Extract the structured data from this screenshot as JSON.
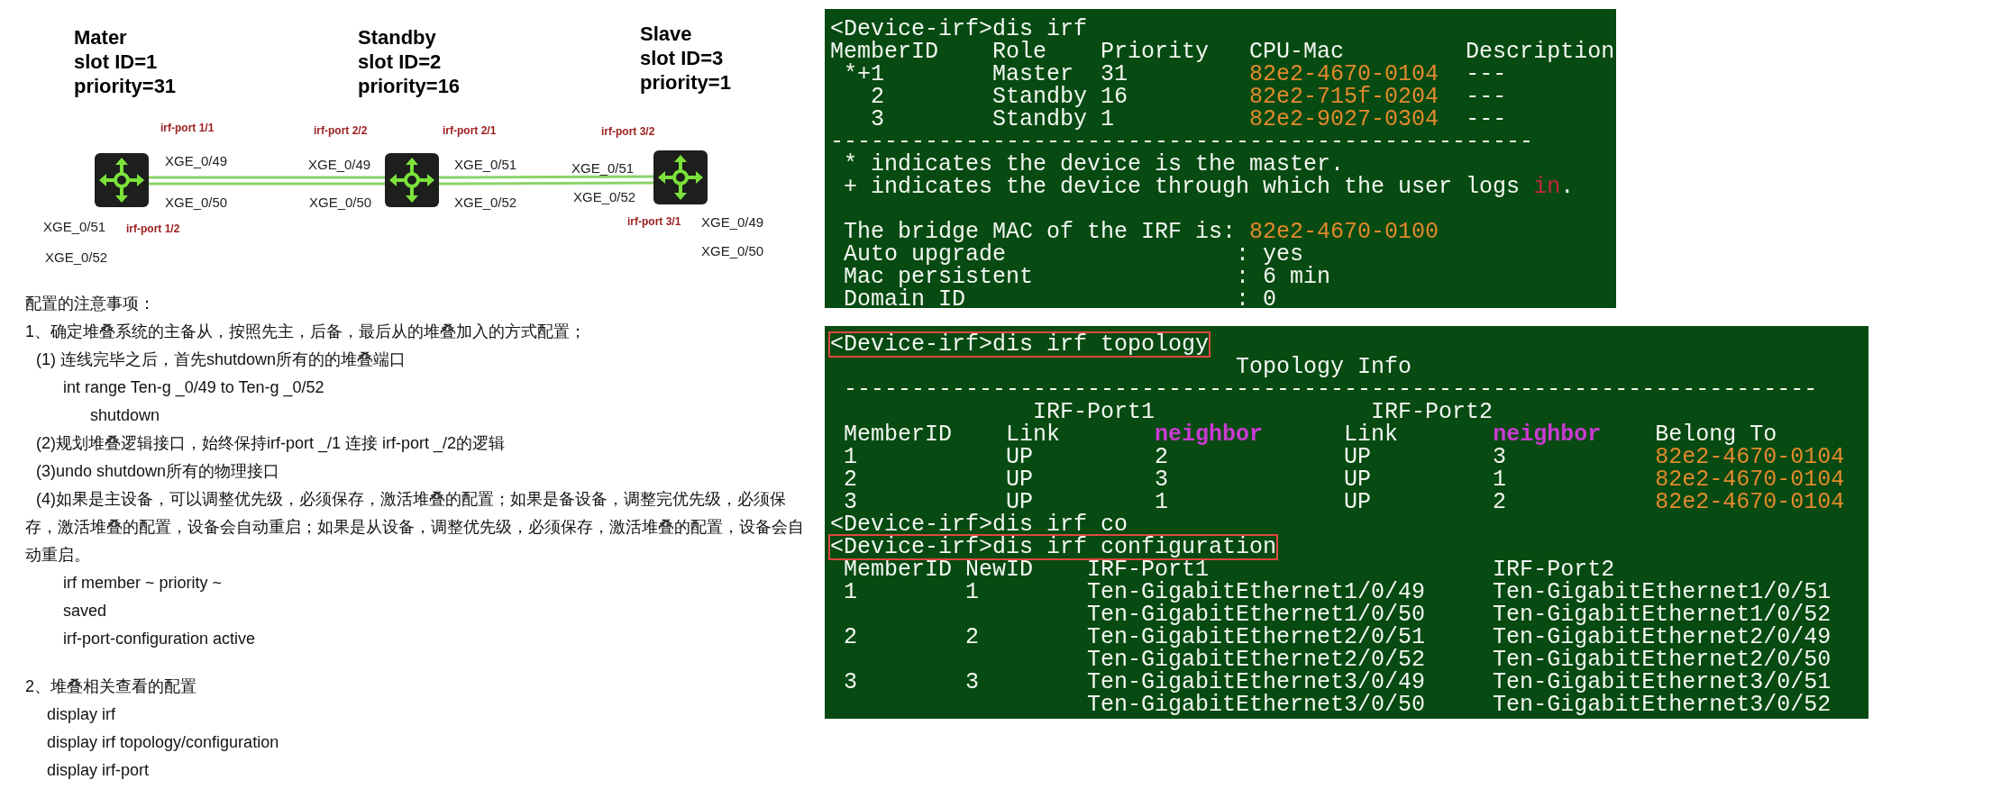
{
  "diagram": {
    "devices": [
      {
        "title": "Mater",
        "slot": "slot ID=1",
        "priority": "priority=31",
        "labels": [
          {
            "text": "irf-port 1/1",
            "kind": "port"
          },
          {
            "text": "XGE_0/49",
            "kind": "interface"
          },
          {
            "text": "XGE_0/50",
            "kind": "interface"
          },
          {
            "text": "XGE_0/51",
            "kind": "interface"
          },
          {
            "text": "irf-port 1/2",
            "kind": "port"
          },
          {
            "text": "XGE_0/52",
            "kind": "interface"
          }
        ]
      },
      {
        "title": "Standby",
        "slot": "slot ID=2",
        "priority": "priority=16",
        "labels": [
          {
            "text": "irf-port 2/2",
            "kind": "port"
          },
          {
            "text": "XGE_0/49",
            "kind": "interface"
          },
          {
            "text": "XGE_0/50",
            "kind": "interface"
          },
          {
            "text": "irf-port 2/1",
            "kind": "port"
          },
          {
            "text": "XGE_0/51",
            "kind": "interface"
          },
          {
            "text": "XGE_0/52",
            "kind": "interface"
          }
        ]
      },
      {
        "title": "Slave",
        "slot": "slot ID=3",
        "priority": "priority=1",
        "labels": [
          {
            "text": "irf-port 3/2",
            "kind": "port"
          },
          {
            "text": "XGE_0/51",
            "kind": "interface"
          },
          {
            "text": "XGE_0/52",
            "kind": "interface"
          },
          {
            "text": "irf-port 3/1",
            "kind": "port"
          },
          {
            "text": "XGE_0/49",
            "kind": "interface"
          },
          {
            "text": "XGE_0/50",
            "kind": "interface"
          }
        ]
      }
    ]
  },
  "notes": [
    {
      "kind": "heading",
      "text": "配置的注意事项："
    },
    {
      "kind": "heading",
      "text": "1、确定堆叠系统的主备从，按照先主，后备，最后从的堆叠加入的方式配置；"
    },
    {
      "kind": "step",
      "text": "(1) 连线完毕之后，首先shutdown所有的的堆叠端口"
    },
    {
      "kind": "command",
      "text": "int range Ten-g _0/49 to Ten-g _0/52"
    },
    {
      "kind": "subcommand",
      "text": "shutdown"
    },
    {
      "kind": "step",
      "text": "(2)规划堆叠逻辑接口，始终保持irf-port _/1 连接 irf-port _/2的逻辑"
    },
    {
      "kind": "step",
      "text": "(3)undo shutdown所有的物理接口"
    },
    {
      "kind": "step",
      "text": "(4)如果是主设备，可以调整优先级，必须保存，激活堆叠的配置；如果是备设备，调整完优先级，必须保存，激活堆叠的配置，设备会自动重启；如果是从设备，调整优先级，必须保存，激活堆叠的配置，设备会自动重启。"
    },
    {
      "kind": "command",
      "text": "irf member ~ priority ~"
    },
    {
      "kind": "command",
      "text": "saved"
    },
    {
      "kind": "command",
      "text": "irf-port-configuration active"
    },
    {
      "kind": "section",
      "text": "2、堆叠相关查看的配置"
    },
    {
      "kind": "view",
      "text": "display irf"
    },
    {
      "kind": "view",
      "text": "display irf topology/configuration"
    },
    {
      "kind": "view",
      "text": "display irf-port"
    }
  ],
  "terminals": [
    {
      "blocks": [
        {
          "lines": [
            {
              "segments": [
                {
                  "kind": "plain",
                  "text": "<Device-irf>dis irf"
                }
              ]
            },
            {
              "segments": [
                {
                  "kind": "plain",
                  "text": "MemberID    Role    Priority   CPU-Mac         Description"
                }
              ]
            },
            {
              "segments": [
                {
                  "kind": "plain",
                  "text": " *+1        Master  31         "
                },
                {
                  "kind": "mac",
                  "text": "82e2-4670-0104"
                },
                {
                  "kind": "plain",
                  "text": "  ---"
                }
              ]
            },
            {
              "segments": [
                {
                  "kind": "plain",
                  "text": "   2        Standby 16         "
                },
                {
                  "kind": "mac",
                  "text": "82e2-715f-0204"
                },
                {
                  "kind": "plain",
                  "text": "  ---"
                }
              ]
            },
            {
              "segments": [
                {
                  "kind": "plain",
                  "text": "   3        Standby 1          "
                },
                {
                  "kind": "mac",
                  "text": "82e2-9027-0304"
                },
                {
                  "kind": "plain",
                  "text": "  ---"
                }
              ]
            },
            {
              "segments": [
                {
                  "kind": "plain",
                  "text": "----------------------------------------------------"
                }
              ]
            },
            {
              "segments": [
                {
                  "kind": "plain",
                  "text": " * indicates the device is the master."
                }
              ]
            },
            {
              "segments": [
                {
                  "kind": "plain",
                  "text": " + indicates the device through which the user logs "
                },
                {
                  "kind": "keyword",
                  "text": "in"
                },
                {
                  "kind": "plain",
                  "text": "."
                }
              ]
            }
          ]
        },
        {
          "lines": [
            {
              "segments": [
                {
                  "kind": "plain",
                  "text": " The bridge MAC of the IRF is: "
                },
                {
                  "kind": "mac",
                  "text": "82e2-4670-0100"
                }
              ]
            },
            {
              "segments": [
                {
                  "kind": "plain",
                  "text": " Auto upgrade                 : yes"
                }
              ]
            },
            {
              "segments": [
                {
                  "kind": "plain",
                  "text": " Mac persistent               : 6 min"
                }
              ]
            },
            {
              "segments": [
                {
                  "kind": "plain",
                  "text": " Domain ID                    : 0"
                }
              ]
            }
          ]
        }
      ]
    },
    {
      "blocks": [
        {
          "lines": [
            {
              "boxed": true,
              "segments": [
                {
                  "kind": "plain",
                  "text": "<Device-irf>dis irf topology"
                }
              ]
            },
            {
              "boxed": false,
              "segments": [
                {
                  "kind": "plain",
                  "text": "                              Topology Info"
                }
              ]
            },
            {
              "boxed": false,
              "segments": [
                {
                  "kind": "plain",
                  "text": " ------------------------------------------------------------------------"
                }
              ]
            },
            {
              "boxed": false,
              "segments": [
                {
                  "kind": "plain",
                  "text": "               IRF-Port1                IRF-Port2"
                }
              ]
            },
            {
              "boxed": false,
              "segments": [
                {
                  "kind": "plain",
                  "text": " MemberID    Link       "
                },
                {
                  "kind": "field",
                  "text": "neighbor"
                },
                {
                  "kind": "plain",
                  "text": "      Link       "
                },
                {
                  "kind": "field",
                  "text": "neighbor"
                },
                {
                  "kind": "plain",
                  "text": "    Belong To"
                }
              ]
            },
            {
              "boxed": false,
              "segments": [
                {
                  "kind": "plain",
                  "text": " 1           UP         2             UP         3           "
                },
                {
                  "kind": "mac",
                  "text": "82e2-4670-0104"
                }
              ]
            },
            {
              "boxed": false,
              "segments": [
                {
                  "kind": "plain",
                  "text": " 2           UP         3             UP         1           "
                },
                {
                  "kind": "mac",
                  "text": "82e2-4670-0104"
                }
              ]
            },
            {
              "boxed": false,
              "segments": [
                {
                  "kind": "plain",
                  "text": " 3           UP         1             UP         2           "
                },
                {
                  "kind": "mac",
                  "text": "82e2-4670-0104"
                }
              ]
            },
            {
              "boxed": false,
              "segments": [
                {
                  "kind": "plain",
                  "text": "<Device-irf>dis irf co"
                }
              ]
            },
            {
              "boxed": true,
              "segments": [
                {
                  "kind": "plain",
                  "text": "<Device-irf>dis irf configuration"
                }
              ]
            },
            {
              "boxed": false,
              "segments": [
                {
                  "kind": "plain",
                  "text": " MemberID NewID    IRF-Port1                     IRF-Port2"
                }
              ]
            },
            {
              "boxed": false,
              "segments": [
                {
                  "kind": "plain",
                  "text": " 1        1        Ten-GigabitEthernet1/0/49     Ten-GigabitEthernet1/0/51"
                }
              ]
            },
            {
              "boxed": false,
              "segments": [
                {
                  "kind": "plain",
                  "text": "                   Ten-GigabitEthernet1/0/50     Ten-GigabitEthernet1/0/52"
                }
              ]
            },
            {
              "boxed": false,
              "segments": [
                {
                  "kind": "plain",
                  "text": " 2        2        Ten-GigabitEthernet2/0/51     Ten-GigabitEthernet2/0/49"
                }
              ]
            },
            {
              "boxed": false,
              "segments": [
                {
                  "kind": "plain",
                  "text": "                   Ten-GigabitEthernet2/0/52     Ten-GigabitEthernet2/0/50"
                }
              ]
            },
            {
              "boxed": false,
              "segments": [
                {
                  "kind": "plain",
                  "text": " 3        3        Ten-GigabitEthernet3/0/49     Ten-GigabitEthernet3/0/51"
                }
              ]
            },
            {
              "boxed": false,
              "segments": [
                {
                  "kind": "plain",
                  "text": "                   Ten-GigabitEthernet3/0/50     Ten-GigabitEthernet3/0/52"
                }
              ]
            }
          ]
        }
      ]
    }
  ]
}
